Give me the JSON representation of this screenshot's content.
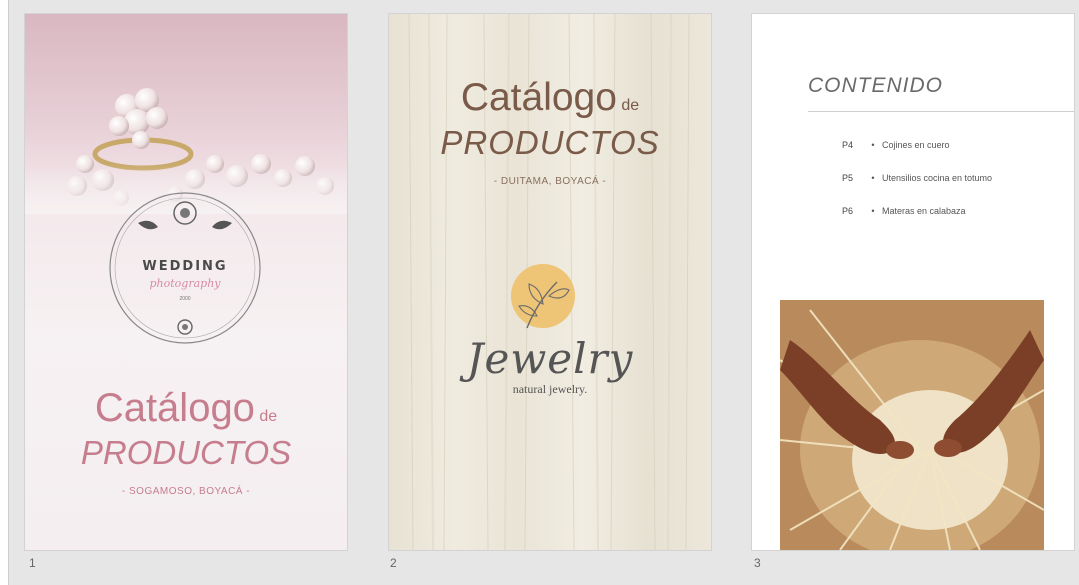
{
  "pages": [
    {
      "number": "1",
      "emblem": {
        "title": "WEDDING",
        "subtitle": "photography",
        "small": "2000"
      },
      "title_main": "Catálogo",
      "title_de": "de",
      "title_products": "PRODUCTOS",
      "location": "- SOGAMOSO, BOYACÁ -"
    },
    {
      "number": "2",
      "title_main": "Catálogo",
      "title_de": "de",
      "title_products": "PRODUCTOS",
      "location": "- DUITAMA, BOYACÁ -",
      "logo_script": "Jewelry",
      "logo_tagline": "natural jewelry."
    },
    {
      "number": "3",
      "heading": "CONTENIDO",
      "toc": [
        {
          "page": "P4",
          "label": "Cojines en cuero"
        },
        {
          "page": "P5",
          "label": "Utensilios cocina en totumo"
        },
        {
          "page": "P6",
          "label": "Materas en calabaza"
        }
      ],
      "bullet": "•"
    }
  ],
  "colors": {
    "background": "#e6e6e6",
    "pink_accent": "#c67d8e",
    "brown_text": "#7a5a48",
    "yellow_circle": "#eec476"
  }
}
